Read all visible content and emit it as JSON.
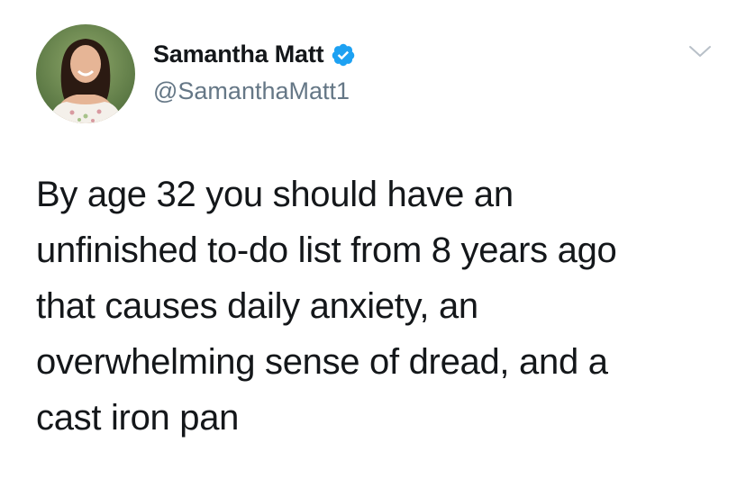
{
  "author": {
    "display_name": "Samantha Matt",
    "handle": "@SamanthaMatt1",
    "verified": true
  },
  "icons": {
    "verified": "verified-badge-icon",
    "menu": "chevron-down-icon"
  },
  "colors": {
    "verified_blue": "#1da1f2",
    "handle_gray": "#657786",
    "text": "#14171a"
  },
  "tweet": {
    "text_lines": [
      "By age 32 you should have an",
      "unfinished to-do list from 8 years ago",
      "that causes daily anxiety, an",
      "overwhelming sense of dread, and a",
      "cast iron pan"
    ]
  }
}
